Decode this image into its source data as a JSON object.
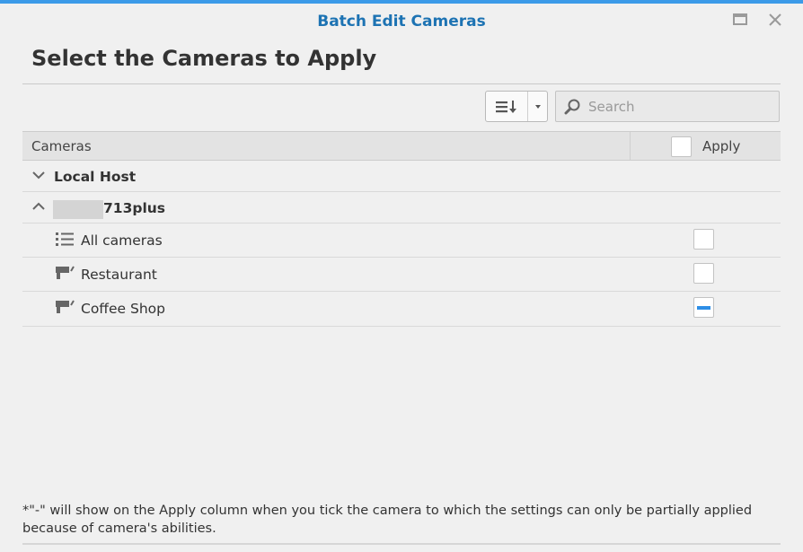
{
  "window": {
    "title": "Batch Edit Cameras",
    "controls": [
      "maximize-icon",
      "close-icon"
    ]
  },
  "section_title": "Select the Cameras to Apply",
  "toolbar": {
    "sort_icon": "sort-list-icon",
    "dropdown_icon": "caret-down-icon",
    "search_placeholder": "Search",
    "search_value": ""
  },
  "grid": {
    "columns": {
      "cameras": "Cameras",
      "apply": "Apply"
    },
    "header_apply_checked": false,
    "groups": [
      {
        "label": "Local Host",
        "expanded": false,
        "icon": "chevron-down-icon"
      },
      {
        "label": "713plus",
        "expanded": true,
        "icon": "chevron-up-icon",
        "name_partially_redacted": true
      }
    ],
    "rows": [
      {
        "label": "All cameras",
        "icon": "list-icon",
        "apply_state": "unchecked"
      },
      {
        "label": "Restaurant",
        "icon": "camera-icon",
        "apply_state": "unchecked"
      },
      {
        "label": "Coffee Shop",
        "icon": "camera-icon",
        "apply_state": "partial"
      }
    ]
  },
  "footnote": "*\"-\" will show on the Apply column when you tick the camera to which the settings can only be partially applied because of camera's abilities.",
  "colors": {
    "accent": "#3b9ae8",
    "title": "#1d73b3",
    "partial_mark": "#2d8ee6"
  }
}
